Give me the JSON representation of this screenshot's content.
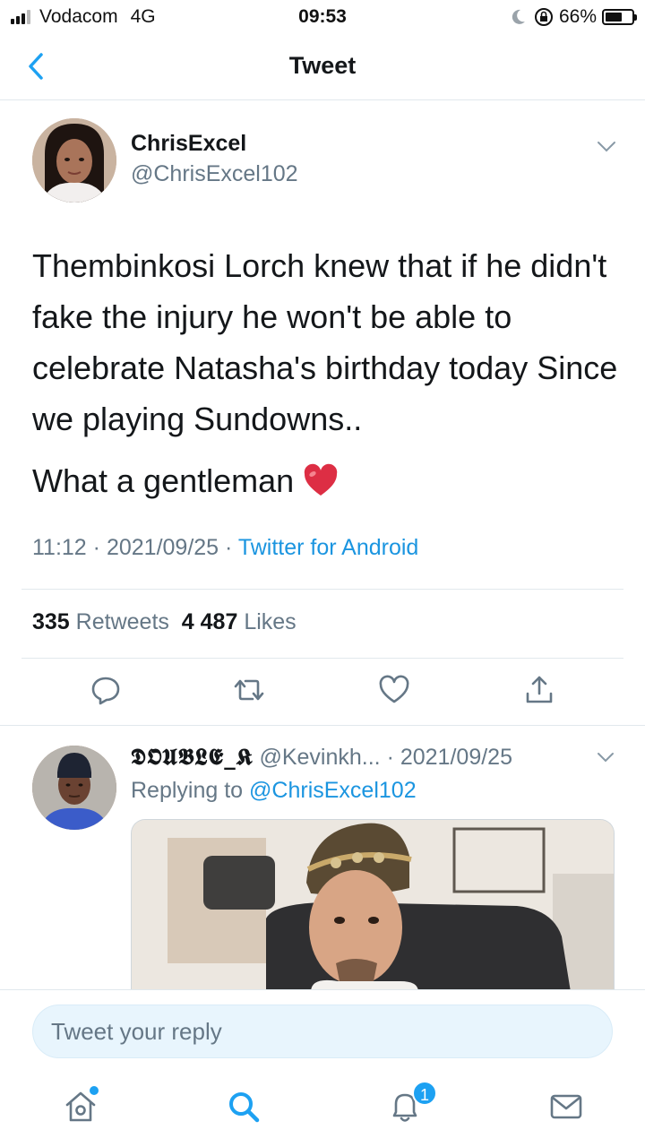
{
  "status_bar": {
    "carrier": "Vodacom",
    "network": "4G",
    "time": "09:53",
    "battery": "66%",
    "battery_level": 0.66,
    "icons": [
      "signal-icon",
      "moon-icon",
      "rotation-lock-icon",
      "battery-icon"
    ]
  },
  "nav": {
    "title": "Tweet",
    "back_icon": "chevron-left-icon"
  },
  "tweet": {
    "author_name": "ChrisExcel",
    "author_handle": "@ChrisExcel102",
    "text": "Thembinkosi Lorch knew that if he didn't fake the injury he won't be able to celebrate Natasha's birthday today Since we playing Sundowns..",
    "text2": "What a gentleman",
    "emoji": "red-heart-emoji",
    "time": "11:12",
    "date": "2021/09/25",
    "source": "Twitter for Android",
    "retweets_count": "335",
    "retweets_label": "Retweets",
    "likes_count": "4 487",
    "likes_label": "Likes",
    "actions": [
      "reply-icon",
      "retweet-icon",
      "like-icon",
      "share-icon"
    ]
  },
  "reply": {
    "author_name": "𝕯𝕺𝖀𝕭𝕷𝕰_𝕶",
    "author_handle": "@Kevinkh...",
    "date": "· 2021/09/25",
    "replying_prefix": "Replying to",
    "replying_to": "@ChrisExcel102"
  },
  "composer": {
    "placeholder": "Tweet your reply"
  },
  "tab_bar": {
    "tabs": [
      "home-icon",
      "search-icon",
      "notifications-icon",
      "messages-icon"
    ],
    "notification_badge": "1",
    "accent": "#1da1f2"
  },
  "colors": {
    "link": "#1b95e0",
    "secondary": "#657786",
    "divider": "#e1e8ed"
  }
}
